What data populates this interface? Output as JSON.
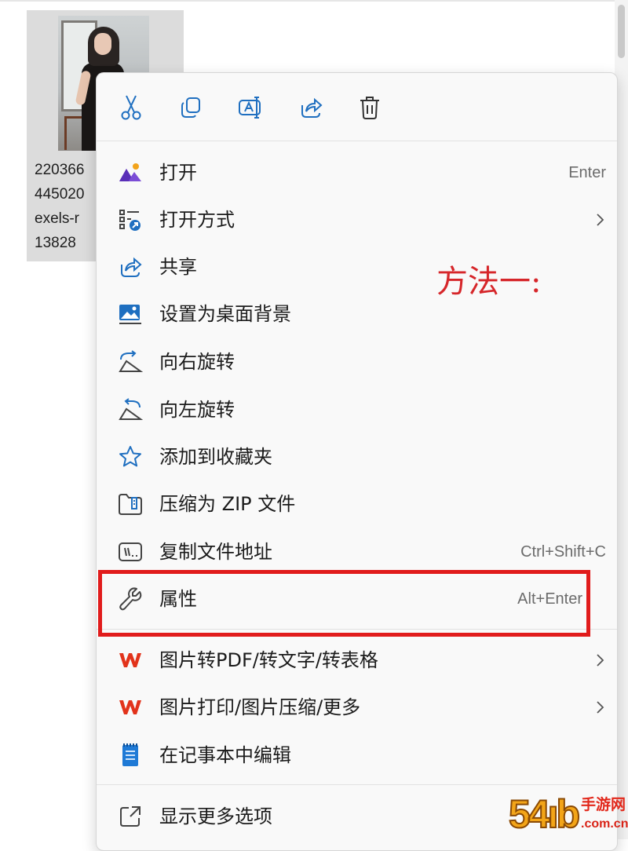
{
  "file": {
    "name_lines": [
      "220366",
      "445020",
      "exels-r",
      "13828"
    ]
  },
  "quick_actions": [
    {
      "icon": "cut-icon"
    },
    {
      "icon": "copy-icon"
    },
    {
      "icon": "rename-icon"
    },
    {
      "icon": "share-icon"
    },
    {
      "icon": "delete-icon"
    }
  ],
  "menu": {
    "items": [
      {
        "label": "打开",
        "shortcut": "Enter",
        "icon": "photos-app-icon"
      },
      {
        "label": "打开方式",
        "shortcut": "",
        "icon": "open-with-icon",
        "submenu": true
      },
      {
        "label": "共享",
        "shortcut": "",
        "icon": "share-icon"
      },
      {
        "label": "设置为桌面背景",
        "shortcut": "",
        "icon": "desktop-background-icon"
      },
      {
        "label": "向右旋转",
        "shortcut": "",
        "icon": "rotate-right-icon"
      },
      {
        "label": "向左旋转",
        "shortcut": "",
        "icon": "rotate-left-icon"
      },
      {
        "label": "添加到收藏夹",
        "shortcut": "",
        "icon": "star-icon"
      },
      {
        "label": "压缩为 ZIP 文件",
        "shortcut": "",
        "icon": "zip-folder-icon"
      },
      {
        "label": "复制文件地址",
        "shortcut": "Ctrl+Shift+C",
        "icon": "copy-path-icon"
      },
      {
        "label": "属性",
        "shortcut": "Alt+Enter",
        "icon": "wrench-icon"
      },
      {
        "label": "图片转PDF/转文字/转表格",
        "shortcut": "",
        "icon": "wps-icon",
        "submenu": true
      },
      {
        "label": "图片打印/图片压缩/更多",
        "shortcut": "",
        "icon": "wps-icon",
        "submenu": true
      },
      {
        "label": "在记事本中编辑",
        "shortcut": "",
        "icon": "notepad-icon"
      },
      {
        "label": "显示更多选项",
        "shortcut": "",
        "icon": "show-more-icon"
      }
    ]
  },
  "annotation": {
    "text": "方法一:",
    "color": "#d6262a"
  },
  "highlight_color": "#e11c1c",
  "watermark": {
    "logo": "54ıb",
    "cn": "手游网",
    "domain": ".com.cn"
  }
}
